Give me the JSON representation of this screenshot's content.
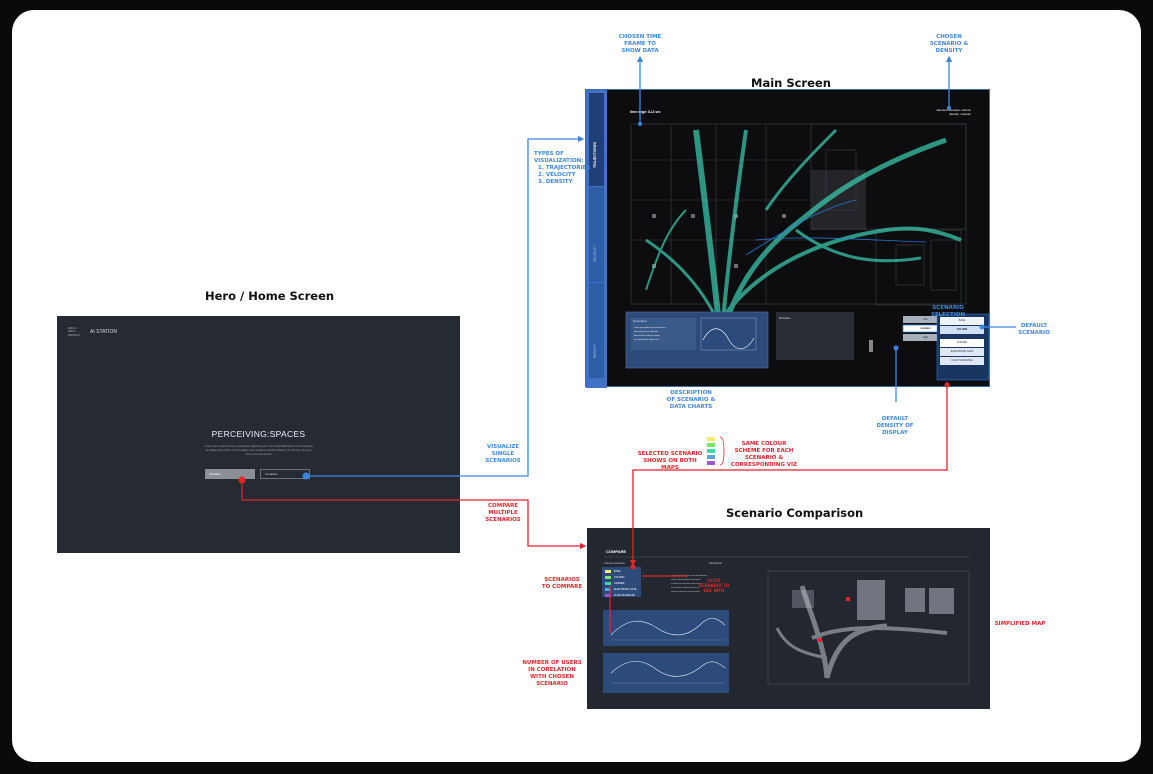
{
  "sections": {
    "hero": "Hero / Home Screen",
    "main": "Main Screen",
    "compare": "Scenario Comparison"
  },
  "hero": {
    "logo": [
      "ARCH",
      "INFO",
      "DESIGN"
    ],
    "app_name": "AI STATION",
    "headline": "PERCEIVING:SPACES",
    "body": "Lorem ipsum dolor sit amet, consectetur adipiscing elit. Nunc sollicitudin libero id velit hendrerit, ac aliquet ante rutrum. Donec aliquet nunc at lectus, id finibus blandit, per rhoncus nisi a per, risus luctus fermentum.",
    "buttons": {
      "visualize": "Visualize",
      "compare": "Compare"
    }
  },
  "main": {
    "tabs": [
      "TRAJECTORIES",
      "VELOCITY",
      "DENSITY"
    ],
    "time_range": "time range: 8-12 sec",
    "scenario_info": [
      "selected scenario: column",
      "density: medium"
    ],
    "description_title": "Description",
    "density_title": "Densities",
    "density_buttons": [
      "low",
      "medium",
      "high"
    ],
    "scenario_buttons": [
      "BASE",
      "COLUMN",
      "CORNER",
      "ELECTRONIC GATE",
      "FLOW STAIRCASE"
    ]
  },
  "annotations": {
    "time_frame": "CHOSEN TIME FRAME TO SHOW DATA",
    "scenario_density": "CHOSEN SCENARIO & DENSITY",
    "types_title": "TYPES OF VISUALIZATION:",
    "types": [
      "1. Trajectories",
      "2. Velocity",
      "3. Density"
    ],
    "scenario_selection": "SCENARIO SELECTION",
    "default_scenario": "DEFAULT SCENARIO",
    "description": "DESCRIPTION OF SCENARIO & DATA CHARTS",
    "default_density": "DEFAULT DENSITY OF DISPLAY",
    "visualize_single": "VISUALIZE SINGLE SCENARIOS",
    "compare_multiple": "COMPARE MULTIPLE SCENARIOS",
    "selected_both": "SELECTED SCENARIO SHOWS ON BOTH MAPS",
    "colour_scheme": "SAME COLOUR SCHEME FOR EACH SCENARIO & CORRESPONDING VIZ",
    "scenarios_compare": "SCENARIOS TO COMPARE",
    "users_correlation": "NUMBER OF USERS IN CORELATION WITH CHOSEN SCENARIO",
    "simplified_map": "SIMPLIFIED MAP",
    "click_scenario": "CLICK SCENARIO TO SEE INFO"
  },
  "compare": {
    "title": "COMPARE",
    "choose_label": "Choose scenarios",
    "description_label": "Description",
    "scenarios": [
      "BASE",
      "COLUMN",
      "CORNER",
      "ELECTRONIC GATE",
      "FLOW STAIRCASE"
    ]
  },
  "colors": {
    "scheme": [
      "#f3ee6a",
      "#7be36a",
      "#3fd6a8",
      "#5aa5e8",
      "#9b55d8"
    ],
    "accent": "#3d86de",
    "red": "#e3242b",
    "teal": "#3fe0c0"
  }
}
